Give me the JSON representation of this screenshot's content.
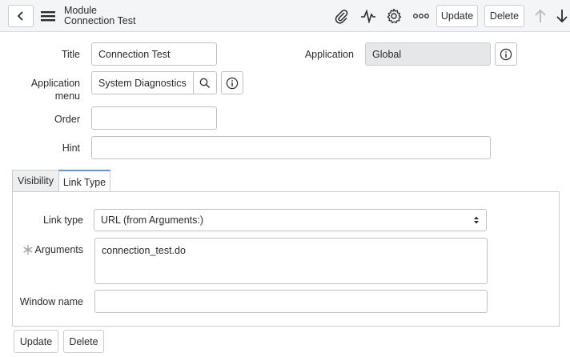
{
  "header": {
    "kind": "Module",
    "title": "Connection Test",
    "update_label": "Update",
    "delete_label": "Delete"
  },
  "form": {
    "title_label": "Title",
    "title_value": "Connection Test",
    "application_label": "Application",
    "application_value": "Global",
    "app_menu_label_line1": "Application",
    "app_menu_label_line2": "menu",
    "app_menu_value": "System Diagnostics",
    "order_label": "Order",
    "order_value": "",
    "hint_label": "Hint",
    "hint_value": ""
  },
  "tabs": [
    {
      "label": "Visibility",
      "active": false
    },
    {
      "label": "Link Type",
      "active": true
    }
  ],
  "link_type_section": {
    "link_type_label": "Link type",
    "link_type_value": "URL (from Arguments:)",
    "arguments_label": "Arguments",
    "arguments_value": "connection_test.do",
    "arguments_required": true,
    "window_name_label": "Window name",
    "window_name_value": ""
  },
  "footer": {
    "update_label": "Update",
    "delete_label": "Delete"
  },
  "colors": {
    "header_bg": "#f4f5f6",
    "active_tab_accent": "#5b9bd5",
    "readonly_bg": "#e6e7e9"
  }
}
